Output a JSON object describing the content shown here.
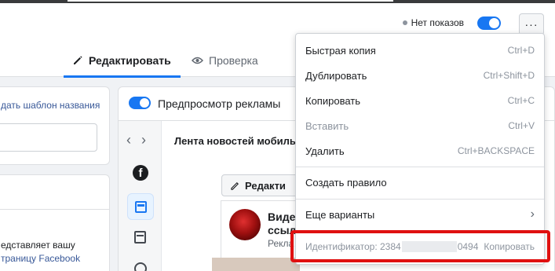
{
  "header": {
    "status_label": "Нет показов",
    "more_label": "···",
    "tabs": [
      {
        "label": "Редактировать",
        "icon": "pencil-icon"
      },
      {
        "label": "Проверка",
        "icon": "eye-icon"
      }
    ]
  },
  "left": {
    "template_link": "дать шаблон названия",
    "info_line1": "едставляет вашу",
    "info_line2": "траницу Facebook"
  },
  "preview": {
    "title": "Предпросмотр рекламы",
    "feed_label": "Лента новостей мобильн",
    "nav_prev": "‹",
    "nav_next": "›",
    "fb_letter": "f",
    "edit_label": "Редакти",
    "post_title_line1": "Виде",
    "post_title_line2": "ссыл",
    "post_sub": "Рекла"
  },
  "menu": {
    "items": [
      {
        "label": "Быстрая копия",
        "shortcut": "Ctrl+D"
      },
      {
        "label": "Дублировать",
        "shortcut": "Ctrl+Shift+D"
      },
      {
        "label": "Копировать",
        "shortcut": "Ctrl+C"
      },
      {
        "label": "Вставить",
        "shortcut": "Ctrl+V"
      },
      {
        "label": "Удалить",
        "shortcut": "Ctrl+BACKSPACE"
      }
    ],
    "create_rule": "Создать правило",
    "more_variants": "Еще варианты",
    "id_label": "Идентификатор: 2384",
    "id_tail": "0494",
    "id_copy": "Копировать"
  },
  "colors": {
    "accent": "#1877f2",
    "highlight": "#e01010"
  }
}
